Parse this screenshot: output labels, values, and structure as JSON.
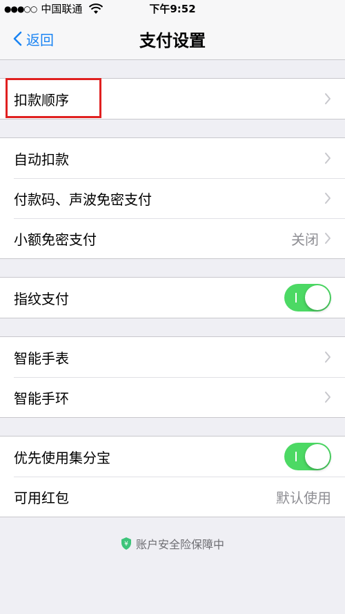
{
  "status_bar": {
    "signal": "●●●○○",
    "carrier": "中国联通",
    "time": "下午9:52"
  },
  "nav": {
    "back_label": "返回",
    "title": "支付设置"
  },
  "groups": [
    {
      "items": [
        {
          "label": "扣款顺序"
        }
      ]
    },
    {
      "items": [
        {
          "label": "自动扣款"
        },
        {
          "label": "付款码、声波免密支付"
        },
        {
          "label": "小额免密支付",
          "value": "关闭"
        }
      ]
    },
    {
      "items": [
        {
          "label": "指纹支付",
          "toggle": true
        }
      ]
    },
    {
      "items": [
        {
          "label": "智能手表"
        },
        {
          "label": "智能手环"
        }
      ]
    },
    {
      "items": [
        {
          "label": "优先使用集分宝",
          "toggle": true
        },
        {
          "label": "可用红包",
          "value": "默认使用"
        }
      ]
    }
  ],
  "footer": {
    "text": "账户安全险保障中"
  },
  "colors": {
    "accent": "#1a84f3",
    "toggle_on": "#4cd964",
    "highlight": "#e02020"
  }
}
